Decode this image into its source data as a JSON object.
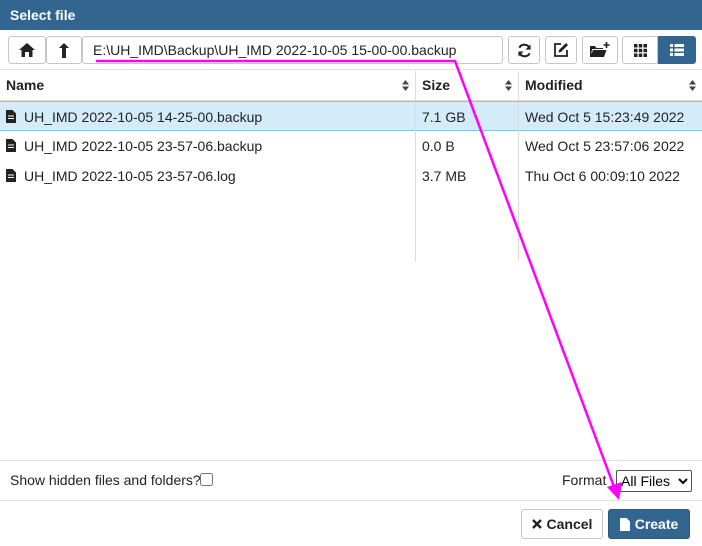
{
  "dialog": {
    "title": "Select file"
  },
  "toolbar": {
    "path": "E:\\UH_IMD\\Backup\\UH_IMD 2022-10-05 15-00-00.backup"
  },
  "columns": {
    "name": "Name",
    "size": "Size",
    "modified": "Modified"
  },
  "files": [
    {
      "name": "UH_IMD 2022-10-05 14-25-00.backup",
      "size": "7.1 GB",
      "modified": "Wed Oct 5 15:23:49 2022",
      "selected": true
    },
    {
      "name": "UH_IMD 2022-10-05 23-57-06.backup",
      "size": "0.0 B",
      "modified": "Wed Oct 5 23:57:06 2022",
      "selected": false
    },
    {
      "name": "UH_IMD 2022-10-05 23-57-06.log",
      "size": "3.7 MB",
      "modified": "Thu Oct 6 00:09:10 2022",
      "selected": false
    }
  ],
  "footer": {
    "show_hidden_label": "Show hidden files and folders?",
    "format_label": "Format",
    "format_selected": "All Files"
  },
  "actions": {
    "cancel_label": "Cancel",
    "create_label": "Create"
  },
  "colors": {
    "header": "#326690",
    "selected_row": "#d4ecfa",
    "annotation": "#ff00ff"
  }
}
